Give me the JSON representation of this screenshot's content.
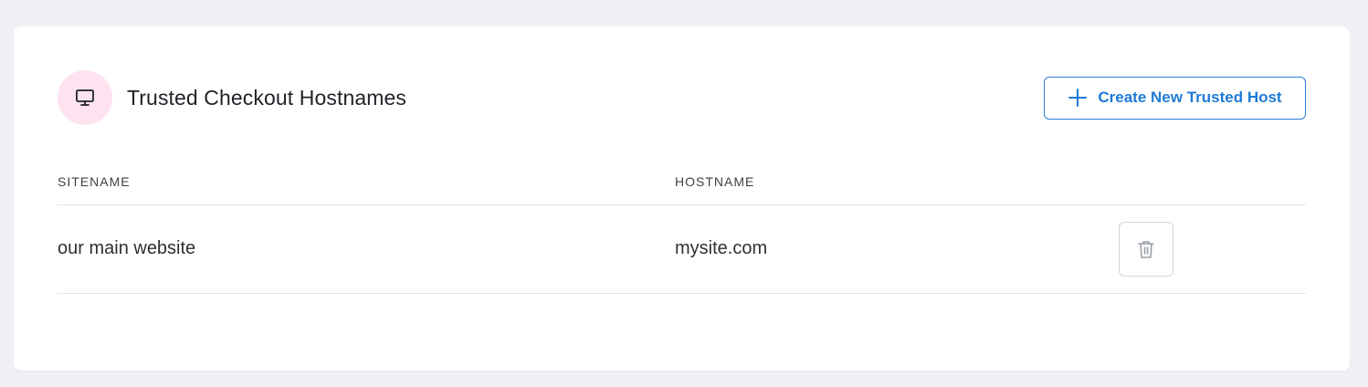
{
  "section": {
    "title": "Trusted Checkout Hostnames",
    "icon": "monitor-icon",
    "create_button_label": "Create New Trusted Host",
    "create_button_icon": "plus-icon"
  },
  "table": {
    "columns": [
      "SITENAME",
      "HOSTNAME"
    ],
    "rows": [
      {
        "sitename": "our main website",
        "hostname": "mysite.com",
        "action_icon": "trash-icon"
      }
    ]
  },
  "colors": {
    "accent": "#1f7ad6",
    "icon_bg": "#fde3f0",
    "page_bg": "#eff0f5"
  }
}
